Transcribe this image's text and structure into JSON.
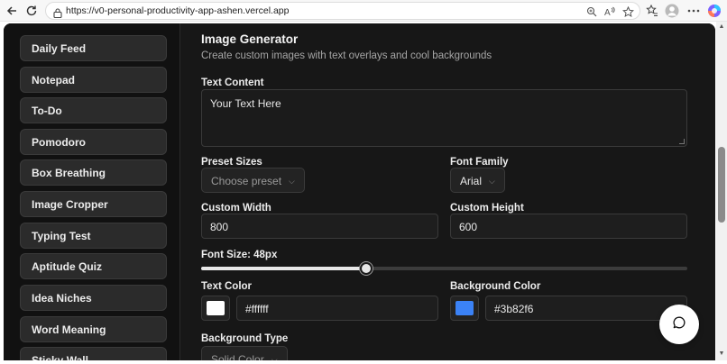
{
  "browser": {
    "url": "https://v0-personal-productivity-app-ashen.vercel.app"
  },
  "sidebar": {
    "items": [
      {
        "label": "Daily Feed"
      },
      {
        "label": "Notepad"
      },
      {
        "label": "To-Do"
      },
      {
        "label": "Pomodoro"
      },
      {
        "label": "Box Breathing"
      },
      {
        "label": "Image Cropper"
      },
      {
        "label": "Typing Test"
      },
      {
        "label": "Aptitude Quiz"
      },
      {
        "label": "Idea Niches"
      },
      {
        "label": "Word Meaning"
      },
      {
        "label": "Sticky Wall"
      }
    ]
  },
  "main": {
    "title": "Image Generator",
    "subtitle": "Create custom images with text overlays and cool backgrounds",
    "text_content": {
      "label": "Text Content",
      "value": "Your Text Here"
    },
    "preset_sizes": {
      "label": "Preset Sizes",
      "placeholder": "Choose preset"
    },
    "font_family": {
      "label": "Font Family",
      "value": "Arial"
    },
    "custom_width": {
      "label": "Custom Width",
      "value": "800"
    },
    "custom_height": {
      "label": "Custom Height",
      "value": "600"
    },
    "font_size": {
      "label": "Font Size: 48px",
      "fraction": 0.34
    },
    "text_color": {
      "label": "Text Color",
      "value": "#ffffff",
      "swatch": "#ffffff"
    },
    "background_color": {
      "label": "Background Color",
      "value": "#3b82f6",
      "swatch": "#3b82f6"
    },
    "background_type": {
      "label": "Background Type",
      "value": "Solid Color"
    }
  },
  "colors": {
    "sidebar_bg": "#111111",
    "content_bg": "#171717",
    "accent_blue": "#3b82f6"
  },
  "icons": [
    "back-icon",
    "refresh-icon",
    "lock-icon",
    "zoom-icon",
    "read-aloud-icon",
    "favorite-icon",
    "collections-icon",
    "profile-icon",
    "more-icon",
    "copilot-icon",
    "chevron-down-icon",
    "chat-icon"
  ]
}
